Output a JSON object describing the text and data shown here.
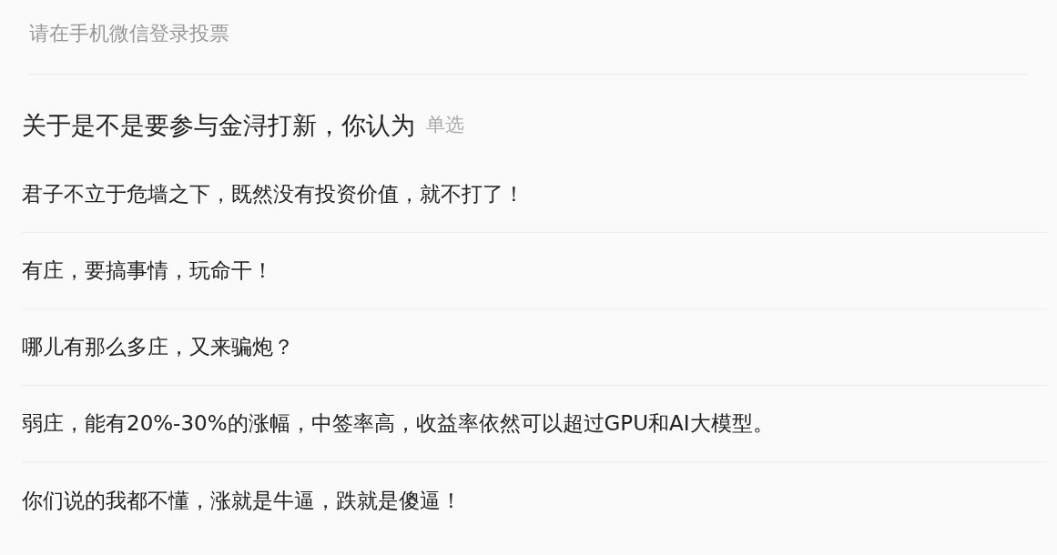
{
  "login_prompt": "请在手机微信登录投票",
  "question": {
    "title": "关于是不是要参与金浔打新，你认为",
    "type_label": "单选"
  },
  "options": [
    {
      "label": "君子不立于危墙之下，既然没有投资价值，就不打了！"
    },
    {
      "label": "有庄，要搞事情，玩命干！"
    },
    {
      "label": "哪儿有那么多庄，又来骗炮？"
    },
    {
      "label": "弱庄，能有20%-30%的涨幅，中签率高，收益率依然可以超过GPU和AI大模型。"
    },
    {
      "label": "你们说的我都不懂，涨就是牛逼，跌就是傻逼！"
    }
  ]
}
